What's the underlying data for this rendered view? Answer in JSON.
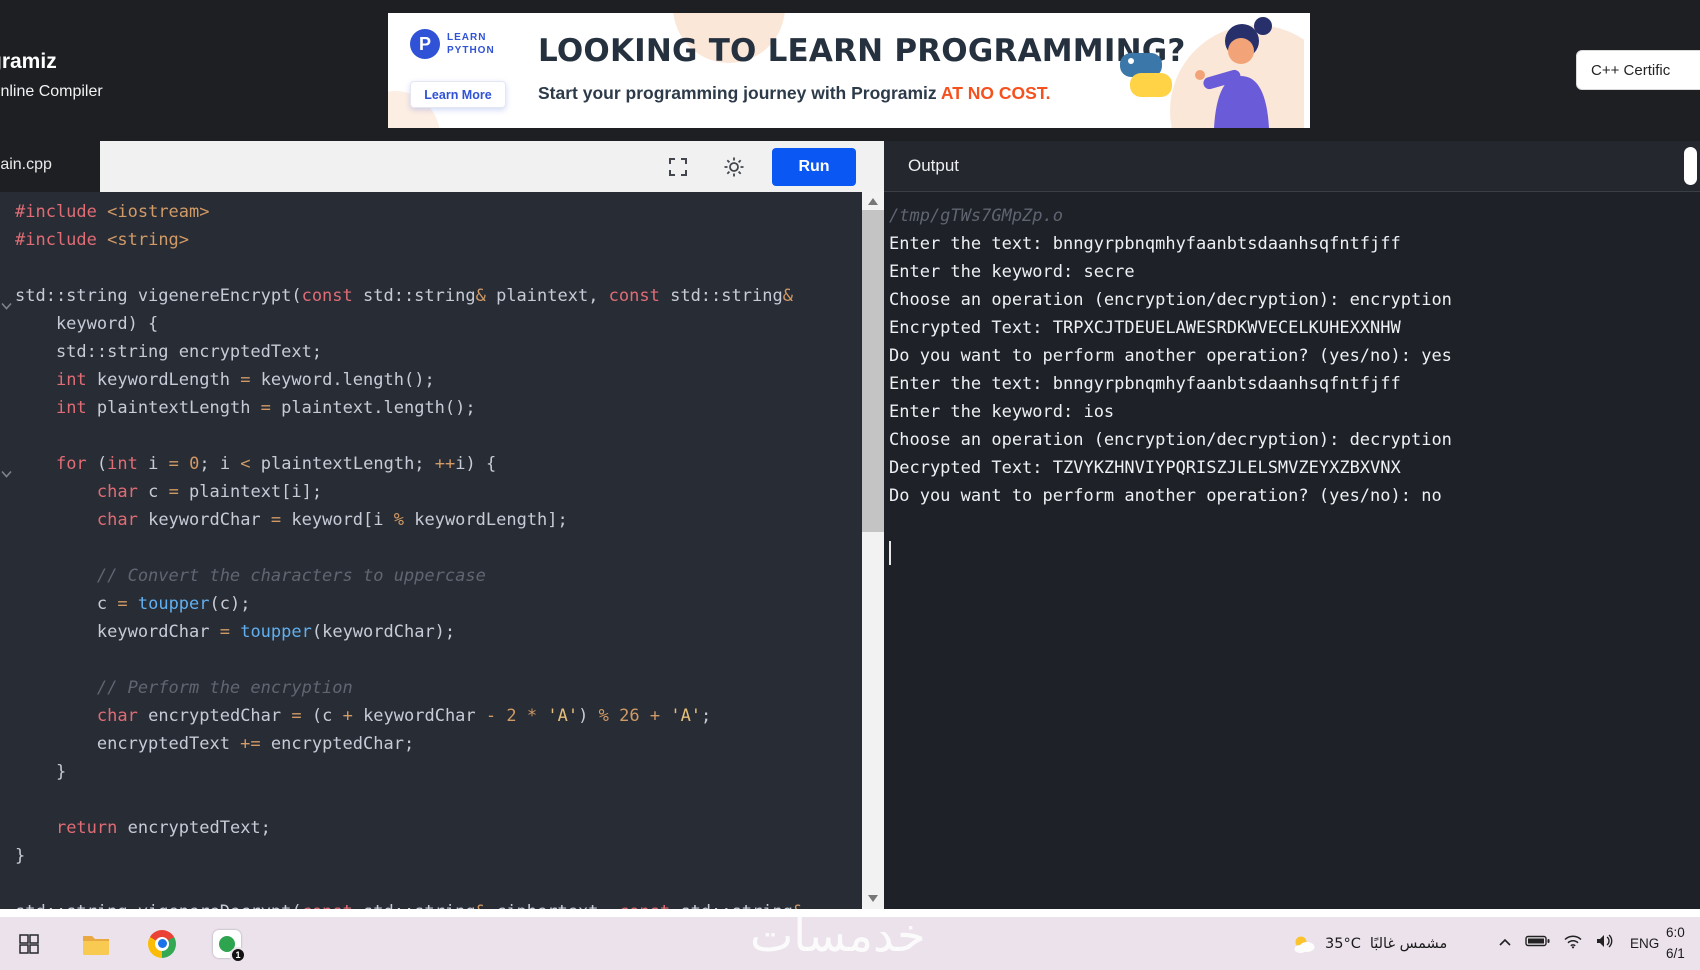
{
  "header": {
    "logo": {
      "line1": "Programiz",
      "line2": "Online Compiler"
    },
    "banner": {
      "brand_initial": "P",
      "brand_top": "LEARN",
      "brand_bottom": "PYTHON",
      "learn_more_label": "Learn More",
      "headline": "LOOKING TO LEARN PROGRAMMING?",
      "subline_prefix": "Start your programming journey with Programiz ",
      "subline_highlight": "AT NO COST."
    },
    "cert_button_label": "C++ Certific"
  },
  "toolbar": {
    "tab_label": "main.cpp",
    "run_label": "Run"
  },
  "output_panel": {
    "title": "Output",
    "lines": [
      {
        "muted": true,
        "text": "/tmp/gTWs7GMpZp.o"
      },
      {
        "text": "Enter the text: bnngyrpbnqmhyfaanbtsdaanhsqfntfjff"
      },
      {
        "text": "Enter the keyword: secre"
      },
      {
        "text": "Choose an operation (encryption/decryption): encryption"
      },
      {
        "text": "Encrypted Text: TRPXCJTDEUELAWESRDKWVECELKUHEXXNHW"
      },
      {
        "text": "Do you want to perform another operation? (yes/no): yes"
      },
      {
        "text": "Enter the text: bnngyrpbnqmhyfaanbtsdaanhsqfntfjff"
      },
      {
        "text": "Enter the keyword: ios"
      },
      {
        "text": "Choose an operation (encryption/decryption): decryption"
      },
      {
        "text": "Decrypted Text: TZVYKZHNVIYPQRISZJLELSMVZEYXZBXVNX"
      },
      {
        "text": "Do you want to perform another operation? (yes/no): no"
      },
      {
        "text": ""
      }
    ]
  },
  "editor": {
    "fold_lines": [
      4,
      10
    ],
    "lines": [
      [
        {
          "c": "kw",
          "t": "#include"
        },
        {
          "c": "pl",
          "t": " "
        },
        {
          "c": "inc",
          "t": "<iostream>"
        }
      ],
      [
        {
          "c": "kw",
          "t": "#include"
        },
        {
          "c": "pl",
          "t": " "
        },
        {
          "c": "inc",
          "t": "<string>"
        }
      ],
      [],
      [
        {
          "c": "pl",
          "t": "std::string vigenereEncrypt("
        },
        {
          "c": "kw",
          "t": "const"
        },
        {
          "c": "pl",
          "t": " std::string"
        },
        {
          "c": "op",
          "t": "&"
        },
        {
          "c": "pl",
          "t": " plaintext, "
        },
        {
          "c": "kw",
          "t": "const"
        },
        {
          "c": "pl",
          "t": " std::string"
        },
        {
          "c": "op",
          "t": "&"
        }
      ],
      [
        {
          "c": "pl",
          "t": "    keyword) {"
        }
      ],
      [
        {
          "c": "pl",
          "t": "    std::string encryptedText;"
        }
      ],
      [
        {
          "c": "pl",
          "t": "    "
        },
        {
          "c": "kw",
          "t": "int"
        },
        {
          "c": "pl",
          "t": " keywordLength "
        },
        {
          "c": "op",
          "t": "="
        },
        {
          "c": "pl",
          "t": " keyword.length();"
        }
      ],
      [
        {
          "c": "pl",
          "t": "    "
        },
        {
          "c": "kw",
          "t": "int"
        },
        {
          "c": "pl",
          "t": " plaintextLength "
        },
        {
          "c": "op",
          "t": "="
        },
        {
          "c": "pl",
          "t": " plaintext.length();"
        }
      ],
      [],
      [
        {
          "c": "pl",
          "t": "    "
        },
        {
          "c": "kw",
          "t": "for"
        },
        {
          "c": "pl",
          "t": " ("
        },
        {
          "c": "kw",
          "t": "int"
        },
        {
          "c": "pl",
          "t": " i "
        },
        {
          "c": "op",
          "t": "="
        },
        {
          "c": "pl",
          "t": " "
        },
        {
          "c": "num",
          "t": "0"
        },
        {
          "c": "pl",
          "t": "; i "
        },
        {
          "c": "op",
          "t": "<"
        },
        {
          "c": "pl",
          "t": " plaintextLength; "
        },
        {
          "c": "op",
          "t": "++"
        },
        {
          "c": "pl",
          "t": "i) {"
        }
      ],
      [
        {
          "c": "pl",
          "t": "        "
        },
        {
          "c": "kw",
          "t": "char"
        },
        {
          "c": "pl",
          "t": " c "
        },
        {
          "c": "op",
          "t": "="
        },
        {
          "c": "pl",
          "t": " plaintext[i];"
        }
      ],
      [
        {
          "c": "pl",
          "t": "        "
        },
        {
          "c": "kw",
          "t": "char"
        },
        {
          "c": "pl",
          "t": " keywordChar "
        },
        {
          "c": "op",
          "t": "="
        },
        {
          "c": "pl",
          "t": " keyword[i "
        },
        {
          "c": "op",
          "t": "%"
        },
        {
          "c": "pl",
          "t": " keywordLength];"
        }
      ],
      [],
      [
        {
          "c": "cm",
          "t": "        // Convert the characters to uppercase"
        }
      ],
      [
        {
          "c": "pl",
          "t": "        c "
        },
        {
          "c": "op",
          "t": "="
        },
        {
          "c": "pl",
          "t": " "
        },
        {
          "c": "fn",
          "t": "toupper"
        },
        {
          "c": "pl",
          "t": "(c);"
        }
      ],
      [
        {
          "c": "pl",
          "t": "        keywordChar "
        },
        {
          "c": "op",
          "t": "="
        },
        {
          "c": "pl",
          "t": " "
        },
        {
          "c": "fn",
          "t": "toupper"
        },
        {
          "c": "pl",
          "t": "(keywordChar);"
        }
      ],
      [],
      [
        {
          "c": "cm",
          "t": "        // Perform the encryption"
        }
      ],
      [
        {
          "c": "pl",
          "t": "        "
        },
        {
          "c": "kw",
          "t": "char"
        },
        {
          "c": "pl",
          "t": " encryptedChar "
        },
        {
          "c": "op",
          "t": "="
        },
        {
          "c": "pl",
          "t": " (c "
        },
        {
          "c": "op",
          "t": "+"
        },
        {
          "c": "pl",
          "t": " keywordChar "
        },
        {
          "c": "op",
          "t": "-"
        },
        {
          "c": "pl",
          "t": " "
        },
        {
          "c": "num",
          "t": "2"
        },
        {
          "c": "pl",
          "t": " "
        },
        {
          "c": "op",
          "t": "*"
        },
        {
          "c": "pl",
          "t": " "
        },
        {
          "c": "str",
          "t": "'A'"
        },
        {
          "c": "pl",
          "t": ") "
        },
        {
          "c": "op",
          "t": "%"
        },
        {
          "c": "pl",
          "t": " "
        },
        {
          "c": "num",
          "t": "26"
        },
        {
          "c": "pl",
          "t": " "
        },
        {
          "c": "op",
          "t": "+"
        },
        {
          "c": "pl",
          "t": " "
        },
        {
          "c": "str",
          "t": "'A'"
        },
        {
          "c": "pl",
          "t": ";"
        }
      ],
      [
        {
          "c": "pl",
          "t": "        encryptedText "
        },
        {
          "c": "op",
          "t": "+="
        },
        {
          "c": "pl",
          "t": " encryptedChar;"
        }
      ],
      [
        {
          "c": "pl",
          "t": "    }"
        }
      ],
      [],
      [
        {
          "c": "pl",
          "t": "    "
        },
        {
          "c": "kw",
          "t": "return"
        },
        {
          "c": "pl",
          "t": " encryptedText;"
        }
      ],
      [
        {
          "c": "pl",
          "t": "}"
        }
      ],
      [],
      [
        {
          "c": "pl",
          "t": "std::string vigenereDecrypt("
        },
        {
          "c": "kw",
          "t": "const"
        },
        {
          "c": "pl",
          "t": " std::string"
        },
        {
          "c": "op",
          "t": "&"
        },
        {
          "c": "pl",
          "t": " ciphertext, "
        },
        {
          "c": "kw",
          "t": "const"
        },
        {
          "c": "pl",
          "t": " std::string"
        },
        {
          "c": "op",
          "t": "&"
        }
      ]
    ]
  },
  "taskbar": {
    "badge": "1",
    "watermark": "خدمسات",
    "weather_temp": "35°C",
    "weather_desc": "مشمس غالبًا",
    "language": "ENG",
    "clock_line1": "6:0",
    "clock_line2": "6/1"
  },
  "colors": {
    "run_button": "#0a57f4",
    "ad_highlight": "#f4511e",
    "brand_blue": "#2f52d6",
    "editor_bg": "#282c34",
    "output_bg": "#1e2127"
  }
}
